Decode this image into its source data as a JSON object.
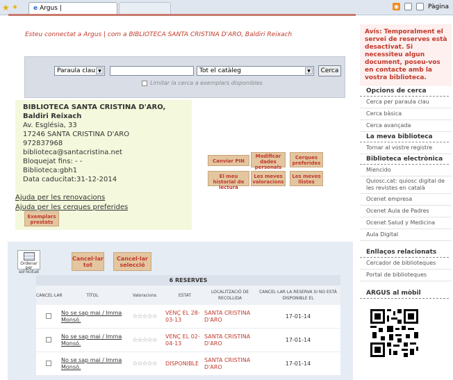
{
  "browser": {
    "tab_title": "Argus |",
    "page_menu": "Pàgina",
    "rss_icon": "rss-icon"
  },
  "header": {
    "connected_text": "Esteu connectat a Argus | com a BIBLIOTECA SANTA CRISTINA D'ARO, Baldiri Reixach"
  },
  "search": {
    "field_option": "Paraula clau",
    "query_value": "",
    "catalog_option": "Tot el catàleg",
    "button_label": "Cerca",
    "limit_label": "Limitar la cerca a exemplars disponibles"
  },
  "user": {
    "name": "BIBLIOTECA SANTA CRISTINA D'ARO, Baldiri Reixach",
    "address": "Av. Església, 33",
    "city": "17246 SANTA CRISTINA D'ARO",
    "phone": "972837968",
    "email": "biblioteca@santacristina.net",
    "blocked": "Bloquejat fins: - -",
    "library": "Biblioteca:gbh1",
    "expiry": "Data caducitat:31-12-2014",
    "loans_button": "Exemplars prestats",
    "help_renewals": "Ajuda per les renovacions",
    "help_searches": "Ajuda per les cerques preferides"
  },
  "actions": {
    "change_pin": "Canviar PIN",
    "modify_data": "Modificar dades personals",
    "preferred_searches": "Cerques preferides",
    "reading_history": "El meu historial de lectura",
    "my_ratings": "Les meves valoracions",
    "my_lists": "Les meves llistes"
  },
  "sidebar": {
    "notice": "Avís: Temporalment el servei de reserves està desactivat. Si necessiteu algun document, poseu-vos en contacte amb la vostra biblioteca.",
    "search_options_title": "Opcions de cerca",
    "search_options": [
      "Cerca per paraula clau",
      "Cerca bàsica",
      "Cerca avançada"
    ],
    "my_library_title": "La meva biblioteca",
    "my_library": [
      "Tornar al vostre registre"
    ],
    "electronic_title": "Biblioteca electrònica",
    "electronic": [
      "Miencido",
      "Quiosc.cat: quiosc digital de les revistes en català",
      "Ocenet empresa",
      "Ocenet Aula de Padres",
      "Ocenet Salud y Medicina",
      "Aula Digital"
    ],
    "related_title": "Enllaços relacionats",
    "related": [
      "Cercador de biblioteques",
      "Portal de biblioteques"
    ],
    "mobile_title": "ARGUS al mòbil",
    "qr_icon": "qr-code-icon"
  },
  "reserves": {
    "sort_label": "Ordenar per sol·licitud",
    "cancel_all": "Cancel·lar tot",
    "cancel_selection": "Cancel·lar selecció",
    "title": "6 RESERVES",
    "columns": [
      "CANCEL·LAR",
      "TÍTOL",
      "Valoracions",
      "ESTAT",
      "LOCALITZACIÓ DE RECOLLIDA",
      "CANCEL·LAR LA RESERVA SI NO ESTÀ DISPONIBLE EL"
    ],
    "rows": [
      {
        "title": "No se sap mai / Imma Monsó.",
        "status": "VENÇ EL 28-03-13",
        "location": "SANTA CRISTINA D'ARO",
        "cancel_date": "17-01-14"
      },
      {
        "title": "No se sap mai / Imma Monsó.",
        "status": "VENÇ EL 02-04-13",
        "location": "SANTA CRISTINA D'ARO",
        "cancel_date": "17-01-14"
      },
      {
        "title": "No se sap mai / Imma Monsó.",
        "status": "DISPONIBLE",
        "location": "SANTA CRISTINA D'ARO",
        "cancel_date": "17-01-14"
      }
    ]
  }
}
